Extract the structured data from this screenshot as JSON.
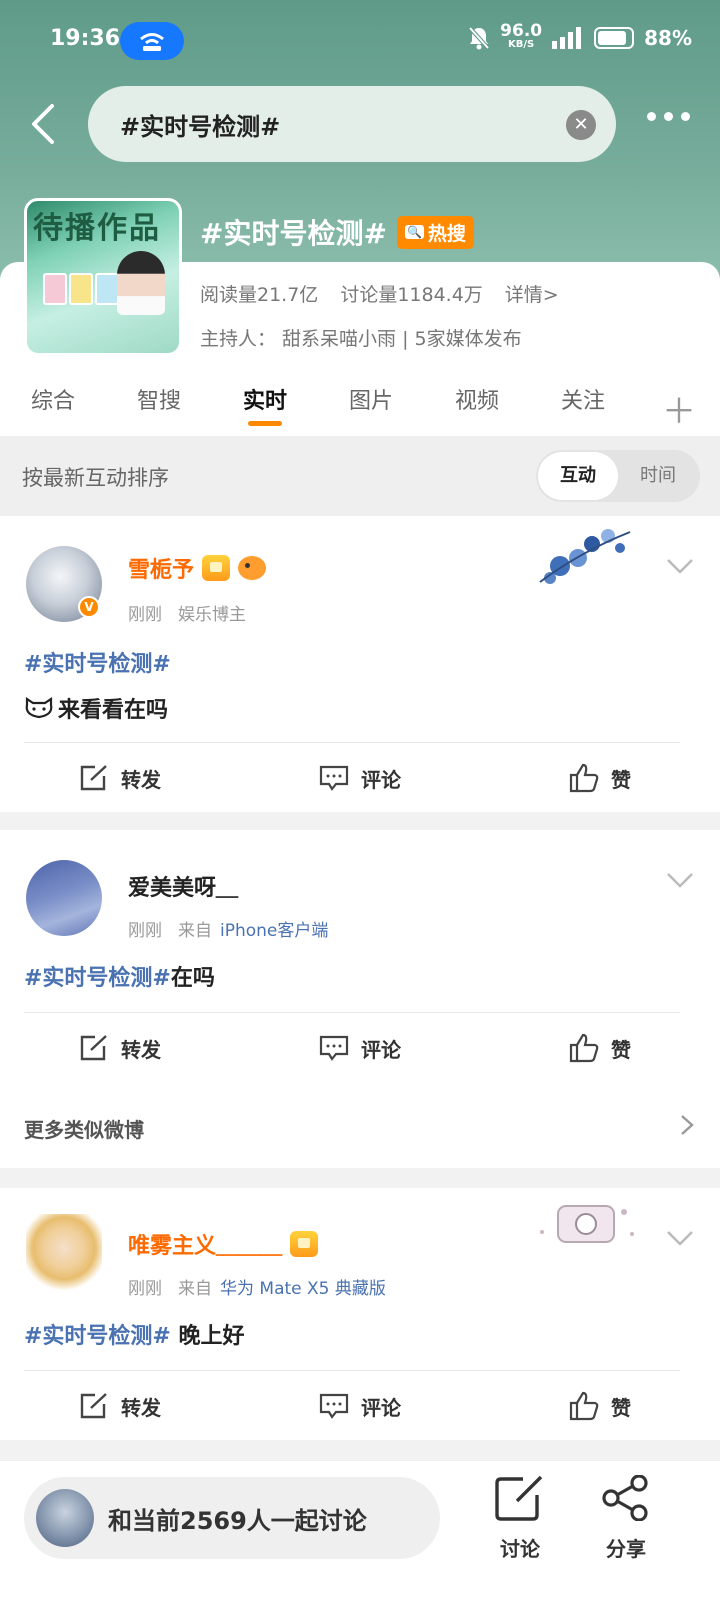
{
  "status_bar": {
    "time": "19:36",
    "net_speed": "96.0",
    "net_unit": "KB/S",
    "battery": "88%"
  },
  "search": {
    "query": "#实时号检测#"
  },
  "topic": {
    "cover_text": "待播作品",
    "title": "#实时号检测#",
    "hot_badge": "热搜",
    "reads": "阅读量21.7亿",
    "discussions": "讨论量1184.4万",
    "detail_link": "详情>",
    "host": "主持人： 甜系呆喵小雨 | 5家媒体发布"
  },
  "tabs": [
    "综合",
    "智搜",
    "实时",
    "图片",
    "视频",
    "关注"
  ],
  "active_tab": "实时",
  "sort": {
    "label": "按最新互动排序",
    "options": [
      "互动",
      "时间"
    ],
    "selected": "互动"
  },
  "actions": {
    "repost": "转发",
    "comment": "评论",
    "like": "赞"
  },
  "posts": [
    {
      "name": "雪栀予",
      "time": "刚刚",
      "source": "娱乐博主",
      "tag": "#实时号检测#",
      "text": "来看看在吗",
      "verified": true
    },
    {
      "name": "爱美美呀＿",
      "time": "刚刚",
      "source_prefix": "来自",
      "source": "iPhone客户端",
      "tag": "#实时号检测#",
      "text": "在吗"
    },
    {
      "name": "唯雾主义＿＿＿",
      "time": "刚刚",
      "source_prefix": "来自",
      "source": "华为 Mate X5 典藏版",
      "tag": "#实时号检测#",
      "text": " 晚上好"
    }
  ],
  "more_similar": "更多类似微博",
  "bottom": {
    "discuss_prompt": "和当前2569人一起讨论",
    "discuss_btn": "讨论",
    "share_btn": "分享"
  },
  "colors": {
    "accent": "#ff8a00",
    "header_green": "#6ea593",
    "link_blue": "#4a72b2",
    "name_orange": "#ff6a00"
  }
}
